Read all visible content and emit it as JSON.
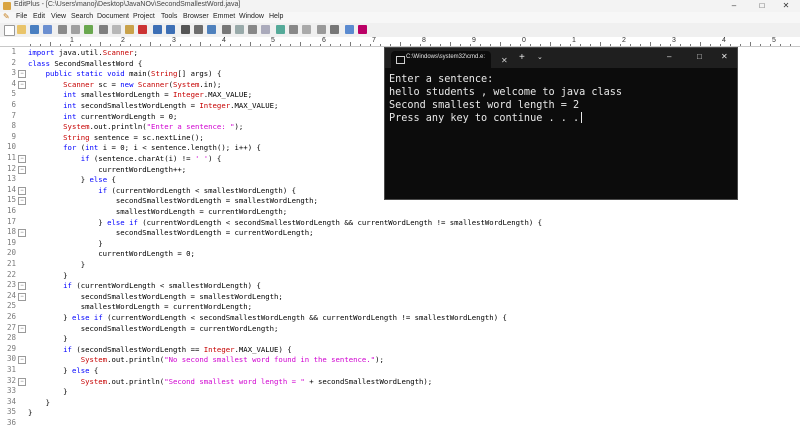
{
  "window": {
    "title": "EditPlus - [C:\\Users\\manoj\\Desktop\\JavaNOv\\SecondSmallestWord.java]",
    "minimize": "–",
    "maximize": "□",
    "close": "✕"
  },
  "menu": [
    "File",
    "Edit",
    "View",
    "Search",
    "Document",
    "Project",
    "Tools",
    "Browser",
    "Emmet",
    "Window",
    "Help"
  ],
  "ruler": [
    "1",
    "2",
    "3",
    "4",
    "5",
    "6",
    "7",
    "8",
    "9",
    "0",
    "1",
    "2",
    "3",
    "4",
    "5"
  ],
  "line_numbers": [
    "1",
    "2",
    "3",
    "4",
    "5",
    "6",
    "7",
    "8",
    "9",
    "10",
    "11",
    "12",
    "13",
    "14",
    "15",
    "16",
    "17",
    "18",
    "19",
    "20",
    "21",
    "22",
    "23",
    "24",
    "25",
    "26",
    "27",
    "28",
    "29",
    "30",
    "31",
    "32",
    "33",
    "34",
    "35",
    "36"
  ],
  "code": [
    "import java.util.Scanner;",
    "class SecondSmallestWord {",
    "    public static void main(String[] args) {",
    "        Scanner sc = new Scanner(System.in);",
    "        int smallestWordLength = Integer.MAX_VALUE;",
    "        int secondSmallestWordLength = Integer.MAX_VALUE;",
    "        int currentWordLength = 0;",
    "        System.out.println(\"Enter a sentence: \");",
    "        String sentence = sc.nextLine();",
    "        for (int i = 0; i < sentence.length(); i++) {",
    "            if (sentence.charAt(i) != ' ') {",
    "                currentWordLength++;",
    "            } else {",
    "                if (currentWordLength < smallestWordLength) {",
    "                    secondSmallestWordLength = smallestWordLength;",
    "                    smallestWordLength = currentWordLength;",
    "                } else if (currentWordLength < secondSmallestWordLength && currentWordLength != smallestWordLength) {",
    "                    secondSmallestWordLength = currentWordLength;",
    "                }",
    "                currentWordLength = 0;",
    "            }",
    "        }",
    "        if (currentWordLength < smallestWordLength) {",
    "            secondSmallestWordLength = smallestWordLength;",
    "            smallestWordLength = currentWordLength;",
    "        } else if (currentWordLength < secondSmallestWordLength && currentWordLength != smallestWordLength) {",
    "            secondSmallestWordLength = currentWordLength;",
    "        }",
    "        if (secondSmallestWordLength == Integer.MAX_VALUE) {",
    "            System.out.println(\"No second smallest word found in the sentence.\");",
    "        } else {",
    "            System.out.println(\"Second smallest word length = \" + secondSmallestWordLength);",
    "        }",
    "    }",
    "}",
    ""
  ],
  "syntax_colors": {
    "keyword": "#0000ff",
    "type": "#c60000",
    "string": "#d000d0",
    "plain": "#000000"
  },
  "console": {
    "tab_title": "C:\\Windows\\system32\\cmd.e:",
    "tab_close": "✕",
    "new_tab": "+",
    "dropdown": "⌄",
    "output": [
      "Enter a sentence:",
      "hello students , welcome to java class",
      "Second smallest word length = 2",
      "Press any key to continue . . ."
    ]
  }
}
